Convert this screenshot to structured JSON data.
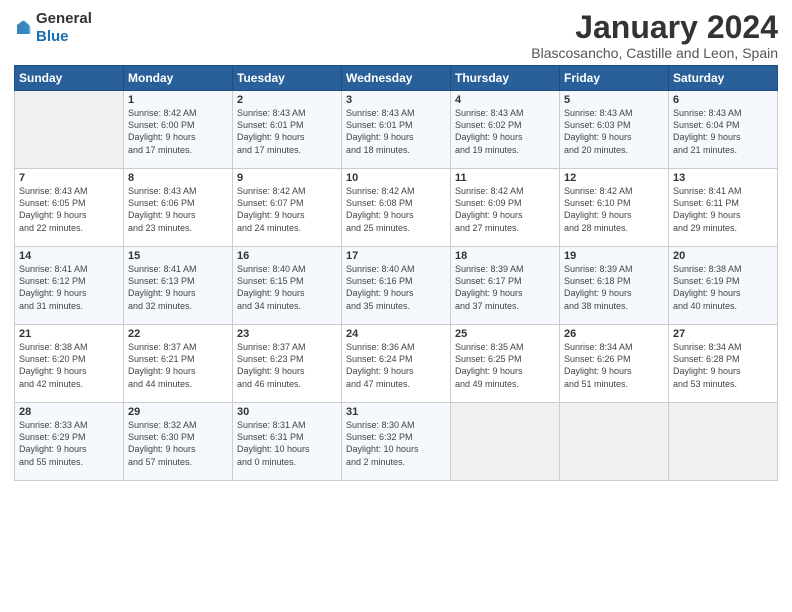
{
  "header": {
    "logo_general": "General",
    "logo_blue": "Blue",
    "title": "January 2024",
    "subtitle": "Blascosancho, Castille and Leon, Spain"
  },
  "weekdays": [
    "Sunday",
    "Monday",
    "Tuesday",
    "Wednesday",
    "Thursday",
    "Friday",
    "Saturday"
  ],
  "weeks": [
    [
      {
        "day": "",
        "info": ""
      },
      {
        "day": "1",
        "info": "Sunrise: 8:42 AM\nSunset: 6:00 PM\nDaylight: 9 hours\nand 17 minutes."
      },
      {
        "day": "2",
        "info": "Sunrise: 8:43 AM\nSunset: 6:01 PM\nDaylight: 9 hours\nand 17 minutes."
      },
      {
        "day": "3",
        "info": "Sunrise: 8:43 AM\nSunset: 6:01 PM\nDaylight: 9 hours\nand 18 minutes."
      },
      {
        "day": "4",
        "info": "Sunrise: 8:43 AM\nSunset: 6:02 PM\nDaylight: 9 hours\nand 19 minutes."
      },
      {
        "day": "5",
        "info": "Sunrise: 8:43 AM\nSunset: 6:03 PM\nDaylight: 9 hours\nand 20 minutes."
      },
      {
        "day": "6",
        "info": "Sunrise: 8:43 AM\nSunset: 6:04 PM\nDaylight: 9 hours\nand 21 minutes."
      }
    ],
    [
      {
        "day": "7",
        "info": "Sunrise: 8:43 AM\nSunset: 6:05 PM\nDaylight: 9 hours\nand 22 minutes."
      },
      {
        "day": "8",
        "info": "Sunrise: 8:43 AM\nSunset: 6:06 PM\nDaylight: 9 hours\nand 23 minutes."
      },
      {
        "day": "9",
        "info": "Sunrise: 8:42 AM\nSunset: 6:07 PM\nDaylight: 9 hours\nand 24 minutes."
      },
      {
        "day": "10",
        "info": "Sunrise: 8:42 AM\nSunset: 6:08 PM\nDaylight: 9 hours\nand 25 minutes."
      },
      {
        "day": "11",
        "info": "Sunrise: 8:42 AM\nSunset: 6:09 PM\nDaylight: 9 hours\nand 27 minutes."
      },
      {
        "day": "12",
        "info": "Sunrise: 8:42 AM\nSunset: 6:10 PM\nDaylight: 9 hours\nand 28 minutes."
      },
      {
        "day": "13",
        "info": "Sunrise: 8:41 AM\nSunset: 6:11 PM\nDaylight: 9 hours\nand 29 minutes."
      }
    ],
    [
      {
        "day": "14",
        "info": "Sunrise: 8:41 AM\nSunset: 6:12 PM\nDaylight: 9 hours\nand 31 minutes."
      },
      {
        "day": "15",
        "info": "Sunrise: 8:41 AM\nSunset: 6:13 PM\nDaylight: 9 hours\nand 32 minutes."
      },
      {
        "day": "16",
        "info": "Sunrise: 8:40 AM\nSunset: 6:15 PM\nDaylight: 9 hours\nand 34 minutes."
      },
      {
        "day": "17",
        "info": "Sunrise: 8:40 AM\nSunset: 6:16 PM\nDaylight: 9 hours\nand 35 minutes."
      },
      {
        "day": "18",
        "info": "Sunrise: 8:39 AM\nSunset: 6:17 PM\nDaylight: 9 hours\nand 37 minutes."
      },
      {
        "day": "19",
        "info": "Sunrise: 8:39 AM\nSunset: 6:18 PM\nDaylight: 9 hours\nand 38 minutes."
      },
      {
        "day": "20",
        "info": "Sunrise: 8:38 AM\nSunset: 6:19 PM\nDaylight: 9 hours\nand 40 minutes."
      }
    ],
    [
      {
        "day": "21",
        "info": "Sunrise: 8:38 AM\nSunset: 6:20 PM\nDaylight: 9 hours\nand 42 minutes."
      },
      {
        "day": "22",
        "info": "Sunrise: 8:37 AM\nSunset: 6:21 PM\nDaylight: 9 hours\nand 44 minutes."
      },
      {
        "day": "23",
        "info": "Sunrise: 8:37 AM\nSunset: 6:23 PM\nDaylight: 9 hours\nand 46 minutes."
      },
      {
        "day": "24",
        "info": "Sunrise: 8:36 AM\nSunset: 6:24 PM\nDaylight: 9 hours\nand 47 minutes."
      },
      {
        "day": "25",
        "info": "Sunrise: 8:35 AM\nSunset: 6:25 PM\nDaylight: 9 hours\nand 49 minutes."
      },
      {
        "day": "26",
        "info": "Sunrise: 8:34 AM\nSunset: 6:26 PM\nDaylight: 9 hours\nand 51 minutes."
      },
      {
        "day": "27",
        "info": "Sunrise: 8:34 AM\nSunset: 6:28 PM\nDaylight: 9 hours\nand 53 minutes."
      }
    ],
    [
      {
        "day": "28",
        "info": "Sunrise: 8:33 AM\nSunset: 6:29 PM\nDaylight: 9 hours\nand 55 minutes."
      },
      {
        "day": "29",
        "info": "Sunrise: 8:32 AM\nSunset: 6:30 PM\nDaylight: 9 hours\nand 57 minutes."
      },
      {
        "day": "30",
        "info": "Sunrise: 8:31 AM\nSunset: 6:31 PM\nDaylight: 10 hours\nand 0 minutes."
      },
      {
        "day": "31",
        "info": "Sunrise: 8:30 AM\nSunset: 6:32 PM\nDaylight: 10 hours\nand 2 minutes."
      },
      {
        "day": "",
        "info": ""
      },
      {
        "day": "",
        "info": ""
      },
      {
        "day": "",
        "info": ""
      }
    ]
  ]
}
